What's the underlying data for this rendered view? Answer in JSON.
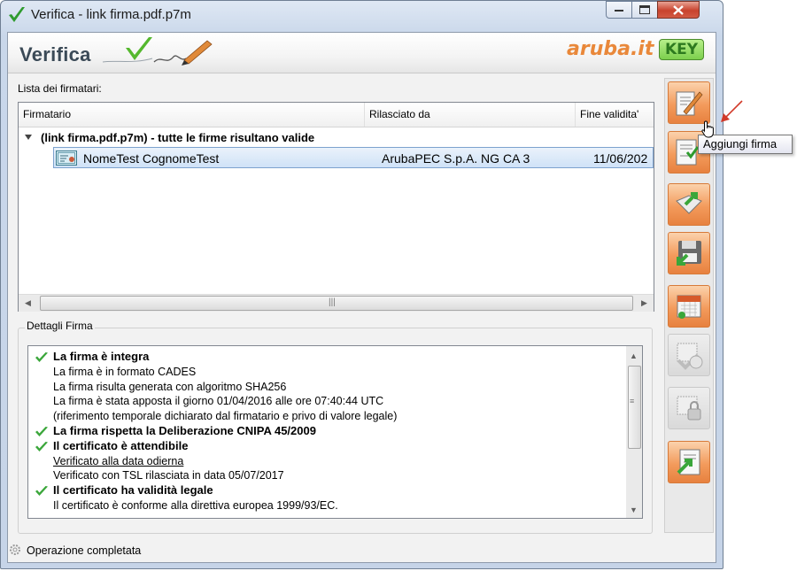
{
  "window": {
    "title": "Verifica - link firma.pdf.p7m",
    "header_title": "Verifica",
    "logo_text": "aruba.it",
    "logo_key": "KEY"
  },
  "list": {
    "label": "Lista dei firmatari:",
    "columns": [
      "Firmatario",
      "Rilasciato da",
      "Fine validita'"
    ],
    "group_label": "(link firma.pdf.p7m) - tutte le firme risultano valide",
    "rows": [
      {
        "signer": "NomeTest CognomeTest",
        "issuer": "ArubaPEC S.p.A. NG CA 3",
        "expiry": "11/06/202"
      }
    ]
  },
  "details": {
    "label": "Dettagli Firma",
    "lines": [
      {
        "text": "La firma è integra",
        "style": "head",
        "check": true
      },
      {
        "text": "La firma è in formato CADES",
        "style": "normal",
        "check": false
      },
      {
        "text": "La firma risulta generata con algoritmo SHA256",
        "style": "normal",
        "check": false
      },
      {
        "text": "La firma è stata apposta il giorno 01/04/2016 alle ore 07:40:44 UTC",
        "style": "normal",
        "check": false
      },
      {
        "text": "(riferimento temporale dichiarato dal firmatario e privo di valore legale)",
        "style": "normal",
        "check": false
      },
      {
        "text": "La firma rispetta la Deliberazione CNIPA 45/2009",
        "style": "head",
        "check": true
      },
      {
        "text": "Il certificato è attendibile",
        "style": "head",
        "check": true
      },
      {
        "text": "Verificato alla data odierna",
        "style": "link",
        "check": false
      },
      {
        "text": "Verificato con TSL rilasciata in data 05/07/2017",
        "style": "normal",
        "check": false
      },
      {
        "text": "Il certificato ha validità legale",
        "style": "head",
        "check": true
      },
      {
        "text": "Il certificato è conforme alla direttiva europea 1999/93/EC.",
        "style": "normal",
        "check": false
      }
    ]
  },
  "status": {
    "text": "Operazione completata"
  },
  "tooltip": {
    "text": "Aggiungi firma"
  },
  "toolbar": {
    "buttons": [
      {
        "icon": "add-signature-icon",
        "enabled": true
      },
      {
        "icon": "countersign-icon",
        "enabled": true
      },
      {
        "icon": "extract-document-icon",
        "enabled": true
      },
      {
        "icon": "save-icon",
        "enabled": true
      },
      {
        "icon": "calendar-timestamp-icon",
        "enabled": true
      },
      {
        "icon": "verify-date-icon",
        "enabled": false
      },
      {
        "icon": "lock-certificate-icon",
        "enabled": false
      },
      {
        "icon": "export-report-icon",
        "enabled": true
      }
    ]
  },
  "colors": {
    "accent_orange": "#f39b5c",
    "selection": "#cfe2f7",
    "check_green": "#3aa63a"
  }
}
